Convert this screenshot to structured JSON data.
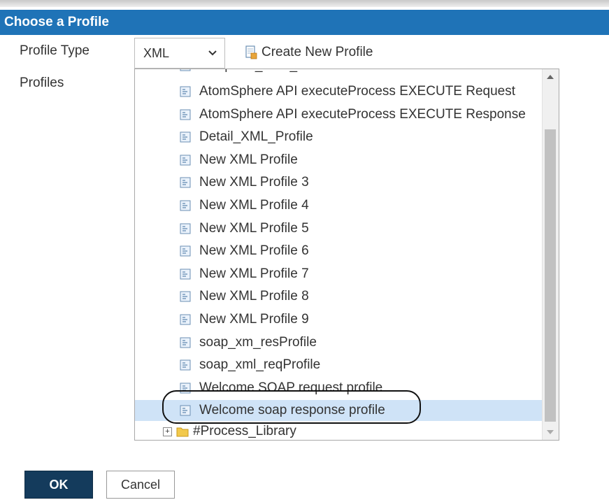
{
  "dialog": {
    "title": "Choose a Profile"
  },
  "form": {
    "profile_type_label": "Profile Type",
    "profile_type_value": "XML",
    "create_new_label": "Create New Profile",
    "profiles_label": "Profiles"
  },
  "profiles": {
    "partial_item": "API | Res_XML_Profile",
    "items": [
      "AtomSphere API executeProcess EXECUTE Request",
      "AtomSphere API executeProcess EXECUTE Response",
      "Detail_XML_Profile",
      "New XML Profile",
      "New XML Profile 3",
      "New XML Profile 4",
      "New XML Profile 5",
      "New XML Profile 6",
      "New XML Profile 7",
      "New XML Profile 8",
      "New XML Profile 9",
      "soap_xm_resProfile",
      "soap_xml_reqProfile",
      "Welcome SOAP request profile",
      "Welcome soap response profile"
    ],
    "selected_item": "Welcome soap response profile",
    "folder": "#Process_Library"
  },
  "buttons": {
    "ok": "OK",
    "cancel": "Cancel"
  },
  "colors": {
    "titlebar": "#1f73b7",
    "ok_button": "#143b5c",
    "selection": "#cfe3f7"
  }
}
